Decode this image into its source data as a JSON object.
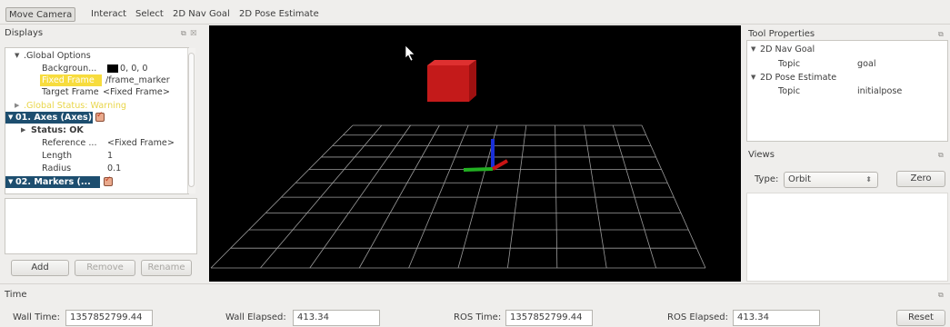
{
  "toolbar": {
    "tools": [
      "Move Camera",
      "Interact",
      "Select",
      "2D Nav Goal",
      "2D Pose Estimate"
    ]
  },
  "displays": {
    "title": "Displays",
    "header_icons": "⧉ ☒",
    "tree": [
      {
        "label": ".Global Options",
        "value": ""
      },
      {
        "label": "Backgroun...",
        "value": "0, 0, 0"
      },
      {
        "label": "Fixed Frame",
        "value": "/frame_marker"
      },
      {
        "label": "Target Frame",
        "value": "<Fixed Frame>"
      },
      {
        "label": ".Global Status: Warning",
        "value": ""
      },
      {
        "label": "01. Axes (Axes)",
        "value": ""
      },
      {
        "label": "Status: OK",
        "value": ""
      },
      {
        "label": "Reference ...",
        "value": "<Fixed Frame>"
      },
      {
        "label": "Length",
        "value": "1"
      },
      {
        "label": "Radius",
        "value": "0.1"
      },
      {
        "label": "02. Markers (...",
        "value": ""
      }
    ],
    "buttons": {
      "add": "Add",
      "remove": "Remove",
      "rename": "Rename"
    }
  },
  "tool_properties": {
    "title": "Tool Properties",
    "items": [
      {
        "label": "2D Nav Goal",
        "value": ""
      },
      {
        "label": "Topic",
        "value": "goal"
      },
      {
        "label": "2D Pose Estimate",
        "value": ""
      },
      {
        "label": "Topic",
        "value": "initialpose"
      }
    ]
  },
  "views": {
    "title": "Views",
    "type_label": "Type:",
    "type_value": "Orbit",
    "zero_button": "Zero"
  },
  "time": {
    "title": "Time",
    "wall_time_label": "Wall Time:",
    "wall_time_value": "1357852799.44",
    "wall_elapsed_label": "Wall Elapsed:",
    "wall_elapsed_value": "413.34",
    "ros_time_label": "ROS Time:",
    "ros_time_value": "1357852799.44",
    "ros_elapsed_label": "ROS Elapsed:",
    "ros_elapsed_value": "413.34",
    "reset_button": "Reset"
  },
  "colors": {
    "selected_row": "#1d4e6f",
    "highlight": "#f7dc3d",
    "warning_text": "#e9d64a",
    "cube": "#c41a1a",
    "axis_x": "#c81414",
    "axis_y": "#22b022",
    "axis_z": "#1a2fd8"
  }
}
